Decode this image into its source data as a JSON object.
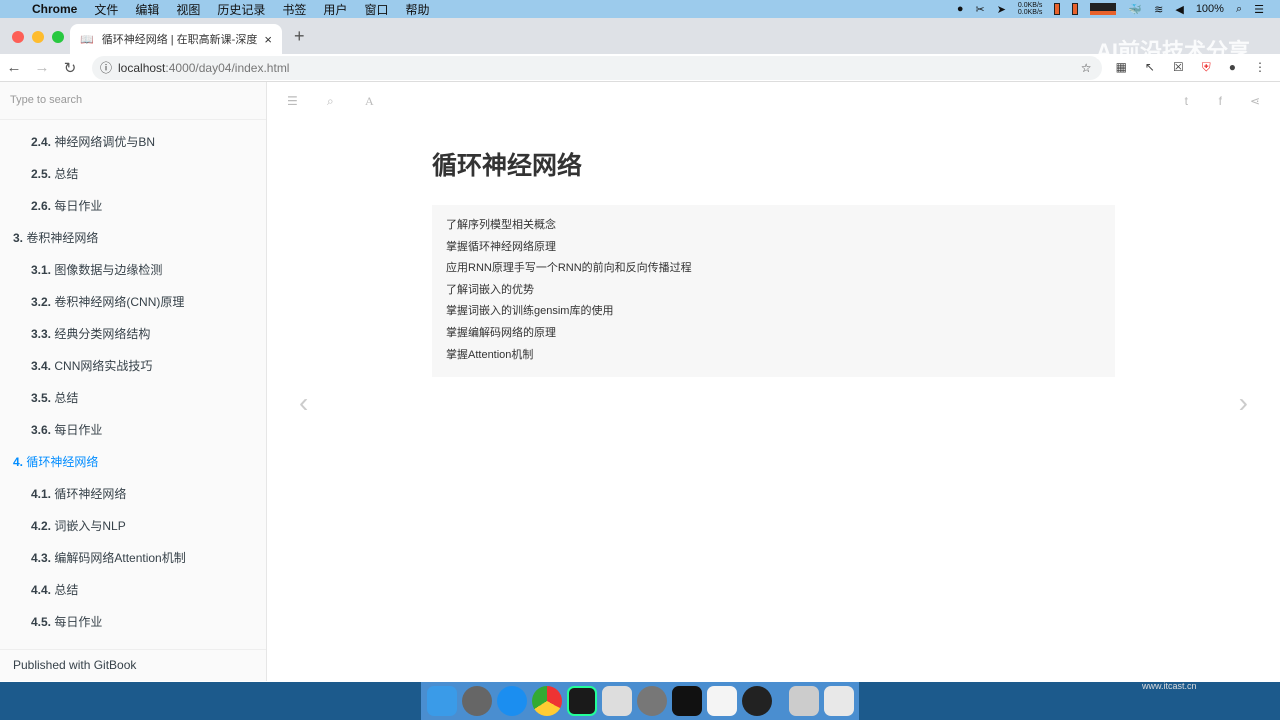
{
  "menubar": {
    "app": "Chrome",
    "items": [
      "文件",
      "编辑",
      "视图",
      "历史记录",
      "书签",
      "用户",
      "窗口",
      "帮助"
    ],
    "net_up": "0.0KB/s",
    "net_down": "0.0KB/s",
    "battery": "100%"
  },
  "browser": {
    "tab_title": "循环神经网络 | 在职高新课-深度",
    "url_host": "localhost",
    "url_path": ":4000/day04/index.html",
    "watermark": "AI前沿技术分享"
  },
  "sidebar": {
    "search_placeholder": "Type to search",
    "items": [
      {
        "num": "2.4.",
        "label": "神经网络调优与BN",
        "level": 2
      },
      {
        "num": "2.5.",
        "label": "总结",
        "level": 2
      },
      {
        "num": "2.6.",
        "label": "每日作业",
        "level": 2
      },
      {
        "num": "3.",
        "label": "卷积神经网络",
        "level": 1
      },
      {
        "num": "3.1.",
        "label": "图像数据与边缘检测",
        "level": 2
      },
      {
        "num": "3.2.",
        "label": "卷积神经网络(CNN)原理",
        "level": 2
      },
      {
        "num": "3.3.",
        "label": "经典分类网络结构",
        "level": 2
      },
      {
        "num": "3.4.",
        "label": "CNN网络实战技巧",
        "level": 2
      },
      {
        "num": "3.5.",
        "label": "总结",
        "level": 2
      },
      {
        "num": "3.6.",
        "label": "每日作业",
        "level": 2
      },
      {
        "num": "4.",
        "label": "循环神经网络",
        "level": 1,
        "active": true
      },
      {
        "num": "4.1.",
        "label": "循环神经网络",
        "level": 2
      },
      {
        "num": "4.2.",
        "label": "词嵌入与NLP",
        "level": 2
      },
      {
        "num": "4.3.",
        "label": "编解码网络Attention机制",
        "level": 2
      },
      {
        "num": "4.4.",
        "label": "总结",
        "level": 2
      },
      {
        "num": "4.5.",
        "label": "每日作业",
        "level": 2
      }
    ],
    "published": "Published with GitBook"
  },
  "page": {
    "title": "循环神经网络",
    "objectives": [
      "了解序列模型相关概念",
      "掌握循环神经网络原理",
      "应用RNN原理手写一个RNN的前向和反向传播过程",
      "了解词嵌入的优势",
      "掌握词嵌入的训练gensim库的使用",
      "掌握编解码网络的原理",
      "掌握Attention机制"
    ]
  },
  "dock": {
    "site": "www.itcast.cn"
  }
}
